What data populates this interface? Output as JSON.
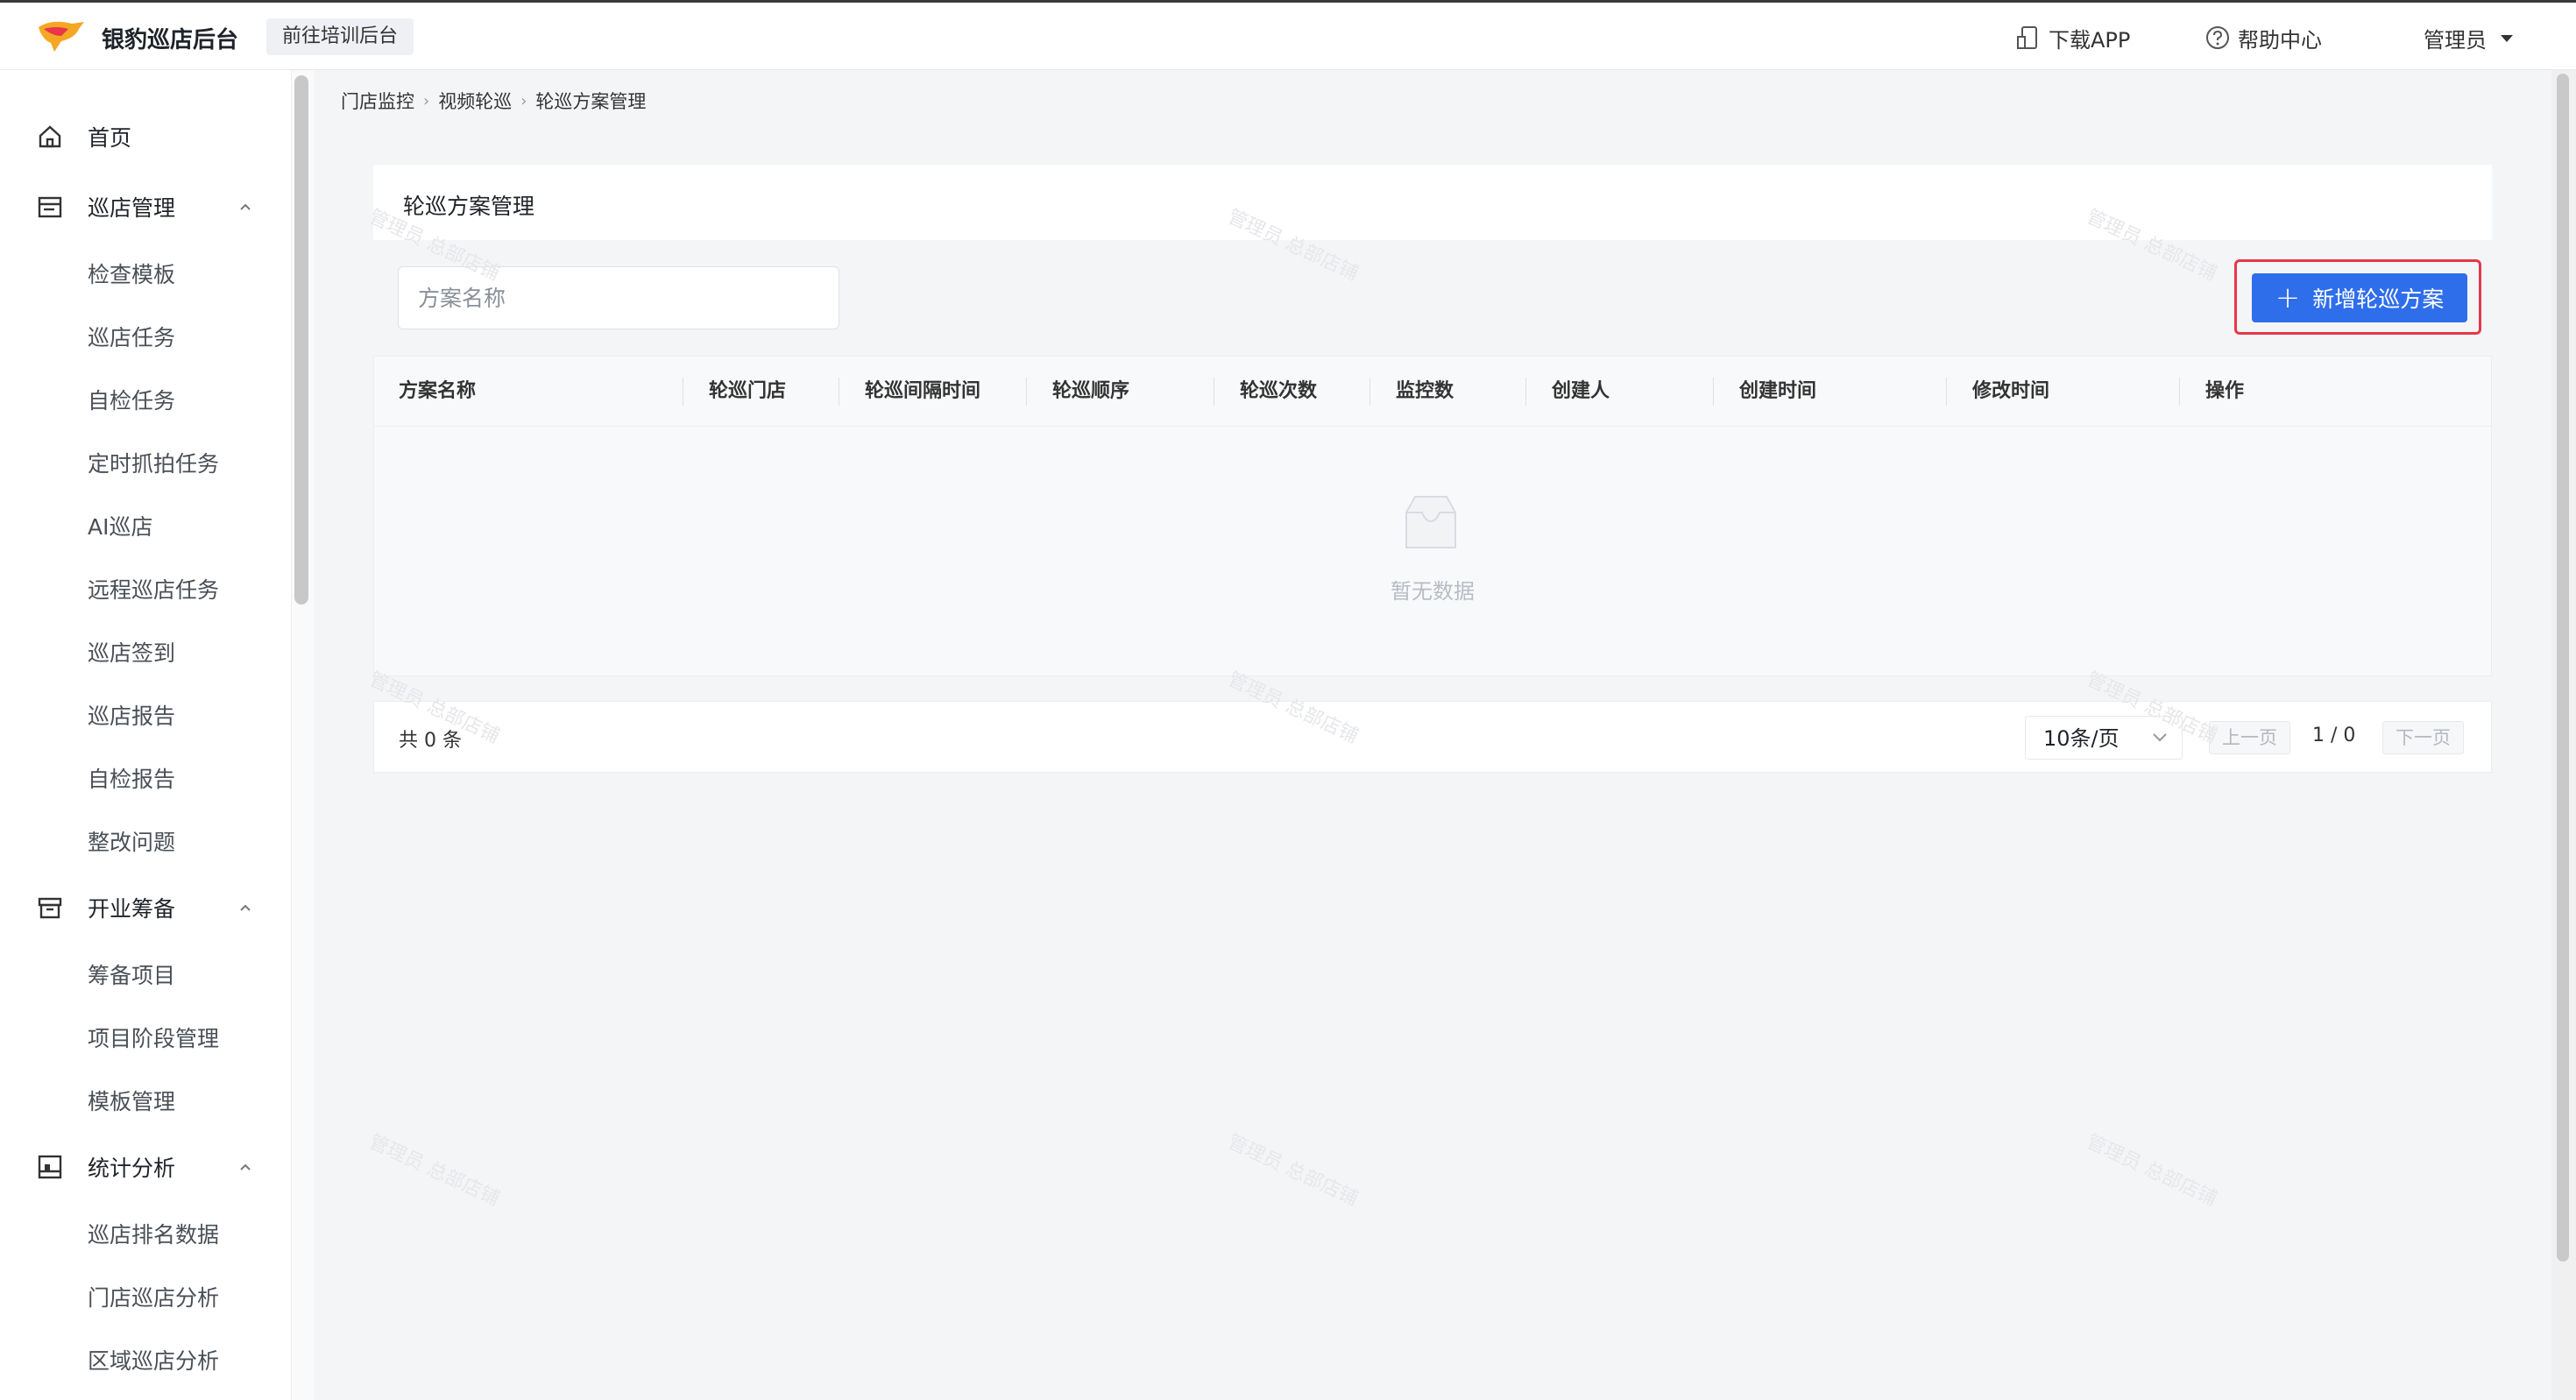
{
  "header": {
    "app_title": "银豹巡店后台",
    "training_label": "前往培训后台",
    "download_label": "下载APP",
    "help_label": "帮助中心",
    "user_label": "管理员"
  },
  "sidebar": {
    "groups": [
      {
        "label": "首页",
        "icon": "home-icon"
      },
      {
        "label": "巡店管理",
        "icon": "calendar-icon",
        "items": [
          "检查模板",
          "巡店任务",
          "自检任务",
          "定时抓拍任务",
          "AI巡店",
          "远程巡店任务",
          "巡店签到",
          "巡店报告",
          "自检报告",
          "整改问题"
        ]
      },
      {
        "label": "开业筹备",
        "icon": "archive-icon",
        "items": [
          "筹备项目",
          "项目阶段管理",
          "模板管理"
        ]
      },
      {
        "label": "统计分析",
        "icon": "chart-icon",
        "items": [
          "巡店排名数据",
          "门店巡店分析",
          "区域巡店分析"
        ]
      }
    ]
  },
  "breadcrumb": [
    "门店监控",
    "视频轮巡",
    "轮巡方案管理"
  ],
  "page_title": "轮巡方案管理",
  "search": {
    "placeholder": "方案名称",
    "value": ""
  },
  "add_button_label": "新增轮巡方案",
  "table": {
    "columns": [
      "方案名称",
      "轮巡门店",
      "轮巡间隔时间",
      "轮巡顺序",
      "轮巡次数",
      "监控数",
      "创建人",
      "创建时间",
      "修改时间",
      "操作"
    ],
    "rows": [],
    "empty_text": "暂无数据"
  },
  "pagination": {
    "total_text": "共 0 条",
    "page_size": "10条/页",
    "prev": "上一页",
    "indicator": "1 / 0",
    "next": "下一页"
  },
  "watermark_text": "管理员 总部店铺",
  "colors": {
    "primary": "#2f6eea",
    "highlight_border": "#e8364a"
  }
}
